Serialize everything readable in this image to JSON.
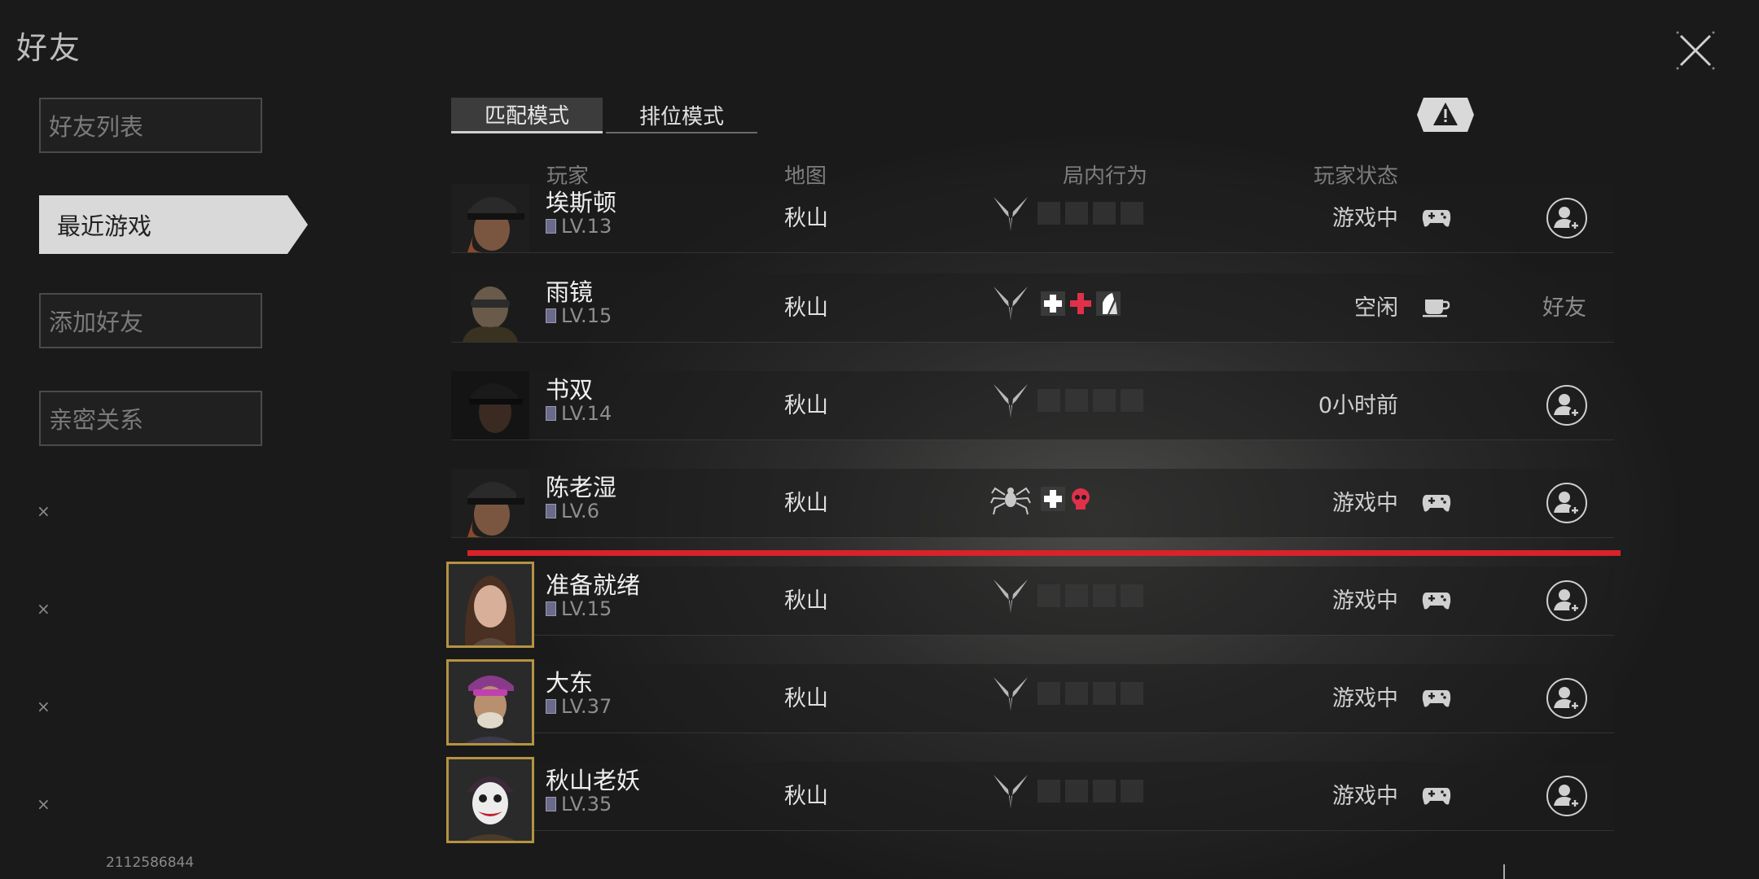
{
  "page_title": "好友",
  "sidebar": {
    "items": [
      {
        "label": "好友列表"
      },
      {
        "label": "最近游戏"
      },
      {
        "label": "添加好友"
      },
      {
        "label": "亲密关系"
      }
    ],
    "x_marks": [
      "×",
      "×",
      "×",
      "×"
    ]
  },
  "user_id": "2112586844",
  "tabs": [
    {
      "label": "匹配模式"
    },
    {
      "label": "排位模式"
    }
  ],
  "columns": {
    "player": "玩家",
    "map": "地图",
    "behavior": "局内行为",
    "status": "玩家状态"
  },
  "rows": [
    {
      "name": "埃斯顿",
      "level": "LV.13",
      "map": "秋山",
      "status": "游戏中",
      "status_icon": "gamepad-icon",
      "action": "add-friend"
    },
    {
      "name": "雨镜",
      "level": "LV.15",
      "map": "秋山",
      "status": "空闲",
      "status_icon": "coffee-icon",
      "action": "好友"
    },
    {
      "name": "书双",
      "level": "LV.14",
      "map": "秋山",
      "status": "0小时前",
      "status_icon": "",
      "action": "add-friend"
    },
    {
      "name": "陈老湿",
      "level": "LV.6",
      "map": "秋山",
      "status": "游戏中",
      "status_icon": "gamepad-icon",
      "action": "add-friend"
    },
    {
      "name": "准备就绪",
      "level": "LV.15",
      "map": "秋山",
      "status": "游戏中",
      "status_icon": "gamepad-icon",
      "action": "add-friend"
    },
    {
      "name": "大东",
      "level": "LV.37",
      "map": "秋山",
      "status": "游戏中",
      "status_icon": "gamepad-icon",
      "action": "add-friend"
    },
    {
      "name": "秋山老妖",
      "level": "LV.35",
      "map": "秋山",
      "status": "游戏中",
      "status_icon": "gamepad-icon",
      "action": "add-friend"
    }
  ],
  "colors": {
    "accent_red": "#d8232a",
    "frame_gold": "#b59341",
    "heal_red": "#e0304a"
  }
}
